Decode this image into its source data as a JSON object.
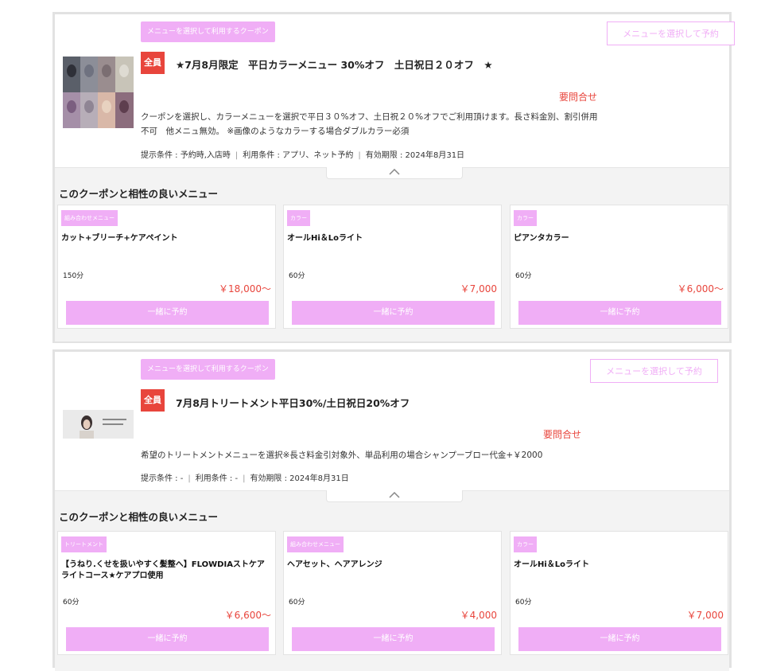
{
  "coupons": [
    {
      "use_label": "メニューを選択して利用するクーポン",
      "select_button": "メニューを選択して予約",
      "tag": "全員",
      "title": "★7月8月限定　平日カラーメニュー 30%オフ　土日祝日２０オフ　★",
      "price": "要問合せ",
      "description": "クーポンを選択し、カラーメニューを選択で平日３０%オフ、土日祝２０%オフでご利用頂けます。長さ料金別、割引併用不可　他メニュ無効。 ※画像のようなカラーする場合ダブルカラー必須",
      "conditions": {
        "presentation": "提示条件 : 予約時,入店時",
        "usage": "利用条件 : アプリ、ネット予約",
        "expiry": "有効期限 :  2024年8月31日"
      },
      "match_heading": "このクーポンと相性の良いメニュー",
      "menus": [
        {
          "category": "組み合わせメニュー",
          "name": "カット+ブリーチ+ケアペイント",
          "duration": "150分",
          "price": "￥18,000～",
          "book": "一緒に予約"
        },
        {
          "category": "カラー",
          "name": "オールHi＆Loライト",
          "duration": "60分",
          "price": "￥7,000",
          "book": "一緒に予約"
        },
        {
          "category": "カラー",
          "name": "ピアンタカラー",
          "duration": "60分",
          "price": "￥6,000～",
          "book": "一緒に予約"
        }
      ]
    },
    {
      "use_label": "メニューを選択して利用するクーポン",
      "select_button": "メニューを選択して予約",
      "tag": "全員",
      "title": "7月8月トリートメント平日30%/土日祝日20%オフ",
      "price": "要問合せ",
      "description": "希望のトリートメントメニューを選択※長さ料金引対象外、単品利用の場合シャンプーブロー代金+￥2000",
      "conditions": {
        "presentation": "提示条件 : -",
        "usage": "利用条件 : -",
        "expiry": "有効期限 :  2024年8月31日"
      },
      "match_heading": "このクーポンと相性の良いメニュー",
      "menus": [
        {
          "category": "トリートメント",
          "name": "【うねり.くせを扱いやすく髪整へ】FLOWDIAストケアライトコース★ケアプロ使用",
          "duration": "60分",
          "price": "￥6,600～",
          "book": "一緒に予約"
        },
        {
          "category": "組み合わせメニュー",
          "name": "ヘアセット、ヘアアレンジ",
          "duration": "60分",
          "price": "￥4,000",
          "book": "一緒に予約"
        },
        {
          "category": "カラー",
          "name": "オールHi＆Loライト",
          "duration": "60分",
          "price": "￥7,000",
          "book": "一緒に予約"
        }
      ]
    }
  ],
  "colors": {
    "accent_pink": "#f0aef6",
    "price_red": "#e8453c"
  }
}
